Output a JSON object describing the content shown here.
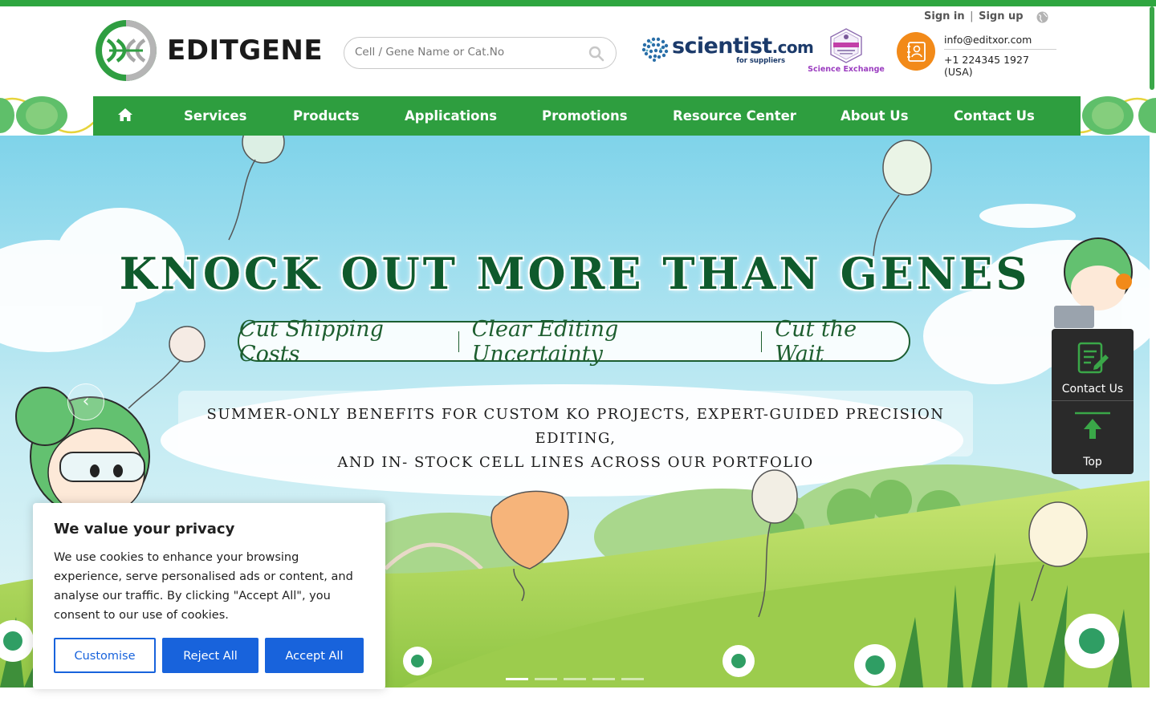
{
  "header": {
    "logo_text": "EDITGENE",
    "search_placeholder": "Cell / Gene Name or Cat.No",
    "scientist_logo_text": "scientist",
    "scientist_logo_tld": ".com",
    "scientist_logo_sub": "for suppliers",
    "science_exchange_label": "Science Exchange",
    "email": "info@editxor.com",
    "phone": "+1 224345 1927 (USA)",
    "sign_in": "Sign in",
    "separator": "|",
    "sign_up": "Sign up"
  },
  "nav": {
    "items": [
      "Services",
      "Products",
      "Applications",
      "Promotions",
      "Resource Center",
      "About Us",
      "Contact Us"
    ]
  },
  "hero": {
    "title": "KNOCK OUT MORE THAN GENES",
    "pill_items": [
      "Cut Shipping Costs",
      "Clear Editing Uncertainty",
      "Cut the Wait"
    ],
    "subtitle_line1": "SUMMER-ONLY BENEFITS FOR CUSTOM KO PROJECTS, EXPERT-GUIDED PRECISION EDITING,",
    "subtitle_line2": "AND IN- STOCK CELL LINES ACROSS OUR PORTFOLIO",
    "prev_arrow": "‹",
    "slides_total": 5,
    "slide_active": 1
  },
  "side_panel": {
    "contact_label": "Contact Us",
    "top_label": "Top"
  },
  "cookie": {
    "title": "We value your privacy",
    "body": "We use cookies to enhance your browsing experience, serve personalised ads or content, and analyse our traffic. By clicking \"Accept All\", you consent to our use of cookies.",
    "customise": "Customise",
    "reject": "Reject All",
    "accept": "Accept All"
  },
  "colors": {
    "brand_green": "#2e9e3f",
    "hero_title": "#0f5a2c",
    "cookie_blue": "#1863dc",
    "contact_orange": "#f28a19"
  }
}
